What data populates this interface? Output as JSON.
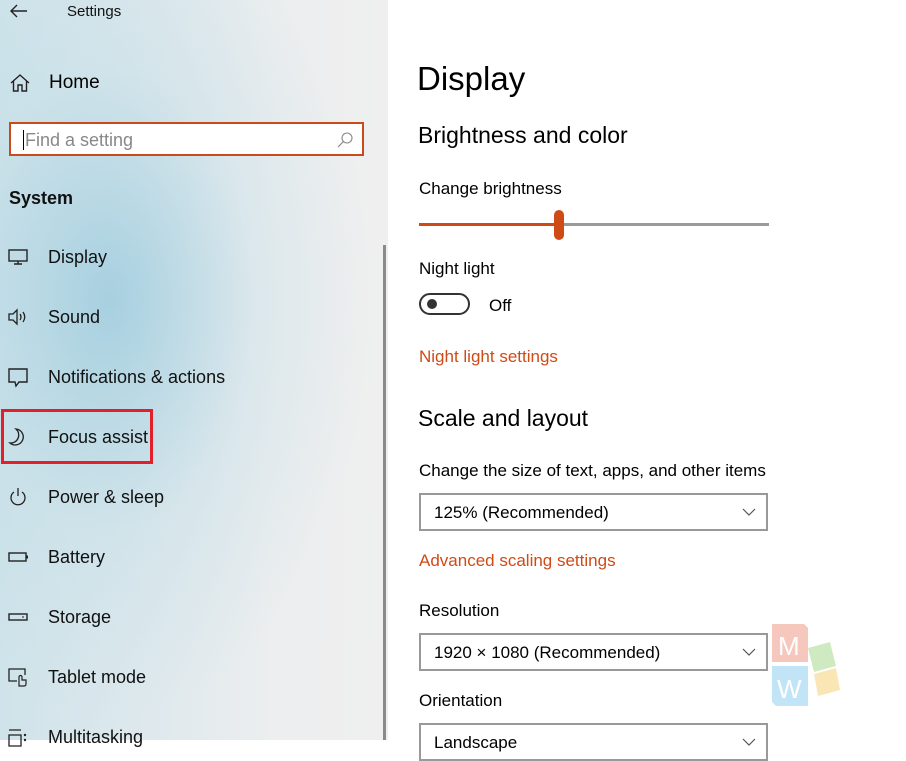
{
  "window": {
    "title": "Settings"
  },
  "sidebar": {
    "home_label": "Home",
    "search": {
      "placeholder": "Find a setting",
      "value": ""
    },
    "section_label": "System",
    "items": [
      {
        "label": "Display",
        "icon": "monitor-icon"
      },
      {
        "label": "Sound",
        "icon": "speaker-icon"
      },
      {
        "label": "Notifications & actions",
        "icon": "notification-icon"
      },
      {
        "label": "Focus assist",
        "icon": "moon-icon",
        "highlighted": true
      },
      {
        "label": "Power & sleep",
        "icon": "power-icon"
      },
      {
        "label": "Battery",
        "icon": "battery-icon"
      },
      {
        "label": "Storage",
        "icon": "storage-icon"
      },
      {
        "label": "Tablet mode",
        "icon": "tablet-mode-icon"
      },
      {
        "label": "Multitasking",
        "icon": "multitasking-icon"
      }
    ]
  },
  "main": {
    "title": "Display",
    "brightness_section": {
      "heading": "Brightness and color",
      "brightness_label": "Change brightness",
      "brightness_value_percent": 40,
      "night_light_label": "Night light",
      "night_light_state": "Off",
      "night_light_on": false,
      "night_light_link": "Night light settings"
    },
    "scale_section": {
      "heading": "Scale and layout",
      "size_label": "Change the size of text, apps, and other items",
      "size_value": "125% (Recommended)",
      "advanced_link": "Advanced scaling settings",
      "resolution_label": "Resolution",
      "resolution_value": "1920 × 1080 (Recommended)",
      "orientation_label": "Orientation",
      "orientation_value": "Landscape"
    }
  },
  "watermark": {
    "letters": [
      "M",
      "W"
    ]
  },
  "colors": {
    "accent": "#d04a16",
    "highlight_box": "#e3202a",
    "search_border": "#c94a1b"
  }
}
